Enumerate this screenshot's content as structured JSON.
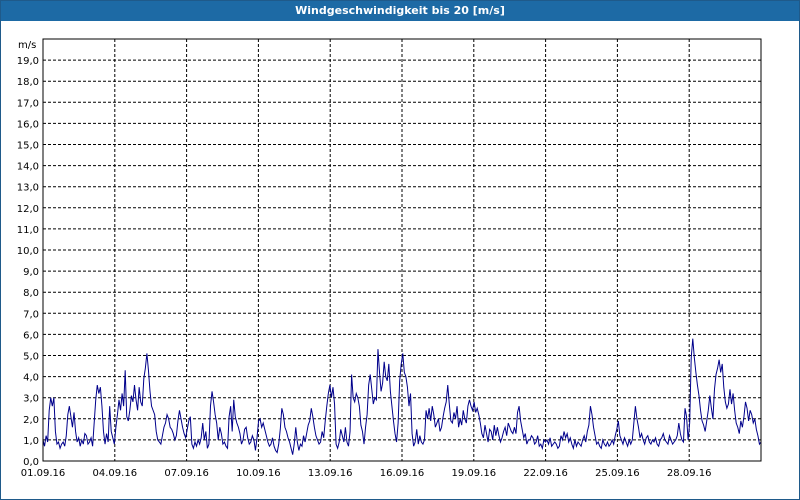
{
  "window": {
    "title": "Windgeschwindigkeit bis 20 [m/s]"
  },
  "chart_data": {
    "type": "line",
    "title": "Windgeschwindigkeit bis 20 [m/s]",
    "ylabel": "m/s",
    "xlabel": "",
    "ylim": [
      0,
      20
    ],
    "xlim_days": [
      0,
      30
    ],
    "y_ticks": [
      "0,0",
      "1,0",
      "2,0",
      "3,0",
      "4,0",
      "5,0",
      "6,0",
      "7,0",
      "8,0",
      "9,0",
      "10,0",
      "11,0",
      "12,0",
      "13,0",
      "14,0",
      "15,0",
      "16,0",
      "17,0",
      "18,0",
      "19,0"
    ],
    "x_ticks": [
      "01.09.16",
      "04.09.16",
      "07.09.16",
      "10.09.16",
      "13.09.16",
      "16.09.16",
      "19.09.16",
      "22.09.16",
      "25.09.16",
      "28.09.16"
    ],
    "grid": true,
    "line_color": "#00008b",
    "series": [
      {
        "x_start": "01.09.16",
        "x_end": "30.09.16",
        "values": [
          1.0,
          0.7,
          1.2,
          0.9,
          2.4,
          3.0,
          2.6,
          3.0,
          1.4,
          0.8,
          0.9,
          0.6,
          0.8,
          0.9,
          0.7,
          1.2,
          2.2,
          2.6,
          2.1,
          1.6,
          2.3,
          1.4,
          0.9,
          1.1,
          0.7,
          1.0,
          0.8,
          1.3,
          1.2,
          0.8,
          0.9,
          1.1,
          0.7,
          1.8,
          2.9,
          3.6,
          3.2,
          3.5,
          2.6,
          1.4,
          0.8,
          1.3,
          0.9,
          2.6,
          1.4,
          1.1,
          0.8,
          1.6,
          2.2,
          2.9,
          2.4,
          3.2,
          2.6,
          4.3,
          2.1,
          1.9,
          2.4,
          3.1,
          2.8,
          3.6,
          2.9,
          2.4,
          3.5,
          2.8,
          2.6,
          3.9,
          4.4,
          5.1,
          4.3,
          3.3,
          2.6,
          2.4,
          2.2,
          1.4,
          1.0,
          0.9,
          0.8,
          1.2,
          1.6,
          1.8,
          2.2,
          2.0,
          1.6,
          1.5,
          1.3,
          1.0,
          1.2,
          1.9,
          2.4,
          2.0,
          1.6,
          1.3,
          1.1,
          1.5,
          1.9,
          2.1,
          0.8,
          0.6,
          0.9,
          0.7,
          1.0,
          0.8,
          1.1,
          1.8,
          1.0,
          1.4,
          0.6,
          0.8,
          2.6,
          3.3,
          2.8,
          2.2,
          1.8,
          1.0,
          1.6,
          1.3,
          0.8,
          0.9,
          0.7,
          0.6,
          2.1,
          2.6,
          1.4,
          2.9,
          2.1,
          1.8,
          1.6,
          1.3,
          0.8,
          1.0,
          1.5,
          1.6,
          1.1,
          0.8,
          0.9,
          1.2,
          1.0,
          0.5,
          1.1,
          1.9,
          2.0,
          1.6,
          1.8,
          1.5,
          1.2,
          0.9,
          0.7,
          0.8,
          1.1,
          0.7,
          0.5,
          0.4,
          0.8,
          1.5,
          2.5,
          2.2,
          1.6,
          1.4,
          1.1,
          0.9,
          0.6,
          0.3,
          0.8,
          1.6,
          0.9,
          0.5,
          0.8,
          0.7,
          1.2,
          0.9,
          1.3,
          1.7,
          1.9,
          2.5,
          2.1,
          1.6,
          1.2,
          1.0,
          0.8,
          0.9,
          1.4,
          1.1,
          1.9,
          2.6,
          3.2,
          3.6,
          3.0,
          3.5,
          2.7,
          0.8,
          0.6,
          0.9,
          1.5,
          1.2,
          0.9,
          1.6,
          0.9,
          0.7,
          1.4,
          4.1,
          3.0,
          2.8,
          3.2,
          3.0,
          2.6,
          1.7,
          1.4,
          0.8,
          1.6,
          2.2,
          3.6,
          4.1,
          3.4,
          2.7,
          3.0,
          2.9,
          5.3,
          4.2,
          3.3,
          3.7,
          4.7,
          4.0,
          3.8,
          4.6,
          3.3,
          2.6,
          1.9,
          1.3,
          0.9,
          1.8,
          3.8,
          4.6,
          5.1,
          4.2,
          4.0,
          3.5,
          2.6,
          3.2,
          1.3,
          0.7,
          0.9,
          1.5,
          0.8,
          1.2,
          0.9,
          0.8,
          1.0,
          2.4,
          2.0,
          2.5,
          1.9,
          2.6,
          2.2,
          1.6,
          1.8,
          2.0,
          1.4,
          1.6,
          2.1,
          2.5,
          2.8,
          3.6,
          2.7,
          1.9,
          1.8,
          2.3,
          2.0,
          2.6,
          1.6,
          2.0,
          1.7,
          2.4,
          2.0,
          1.8,
          2.6,
          2.9,
          2.6,
          2.4,
          2.8,
          2.3,
          2.5,
          2.2,
          1.8,
          1.3,
          1.1,
          1.7,
          1.3,
          0.9,
          1.5,
          1.4,
          1.0,
          1.7,
          1.2,
          1.6,
          1.2,
          0.9,
          1.1,
          1.4,
          1.6,
          1.2,
          1.8,
          1.6,
          1.4,
          1.3,
          1.6,
          1.3,
          2.3,
          2.6,
          1.9,
          1.5,
          1.1,
          1.3,
          0.8,
          1.0,
          1.0,
          1.2,
          1.1,
          0.8,
          0.9,
          1.2,
          0.7,
          0.8,
          0.6,
          1.0,
          0.9,
          1.0,
          0.8,
          1.1,
          0.7,
          0.8,
          0.9,
          0.8,
          0.6,
          0.7,
          1.2,
          1.0,
          1.4,
          1.1,
          1.3,
          0.9,
          1.1,
          0.8,
          0.6,
          1.0,
          0.7,
          0.9,
          0.8,
          0.7,
          1.0,
          1.2,
          0.9,
          1.4,
          1.7,
          2.6,
          2.2,
          1.6,
          1.2,
          0.8,
          0.9,
          0.7,
          0.6,
          1.0,
          0.8,
          0.7,
          0.9,
          0.7,
          0.8,
          1.0,
          0.8,
          1.2,
          1.5,
          1.9,
          1.2,
          1.0,
          0.8,
          1.1,
          0.9,
          0.7,
          1.0,
          0.8,
          1.0,
          1.8,
          2.6,
          2.0,
          1.6,
          1.1,
          1.3,
          1.0,
          0.8,
          1.1,
          1.2,
          0.9,
          0.8,
          1.0,
          0.9,
          1.1,
          0.8,
          0.7,
          1.0,
          1.1,
          1.3,
          1.0,
          0.9,
          0.8,
          1.2,
          1.0,
          0.8,
          0.9,
          1.0,
          1.2,
          1.8,
          1.3,
          1.0,
          0.9,
          2.5,
          2.1,
          1.0,
          1.8,
          4.9,
          5.8,
          4.9,
          4.2,
          3.6,
          3.1,
          2.4,
          1.9,
          1.7,
          1.4,
          1.9,
          2.4,
          3.1,
          2.5,
          2.0,
          3.4,
          4.1,
          4.4,
          4.8,
          4.2,
          4.6,
          3.5,
          2.8,
          2.5,
          2.7,
          3.4,
          2.7,
          3.2,
          2.4,
          1.8,
          1.6,
          1.3,
          1.9,
          1.6,
          2.1,
          2.8,
          2.5,
          1.9,
          2.4,
          2.2,
          1.8,
          2.0,
          1.5,
          1.2,
          0.8,
          0.9
        ]
      }
    ]
  }
}
